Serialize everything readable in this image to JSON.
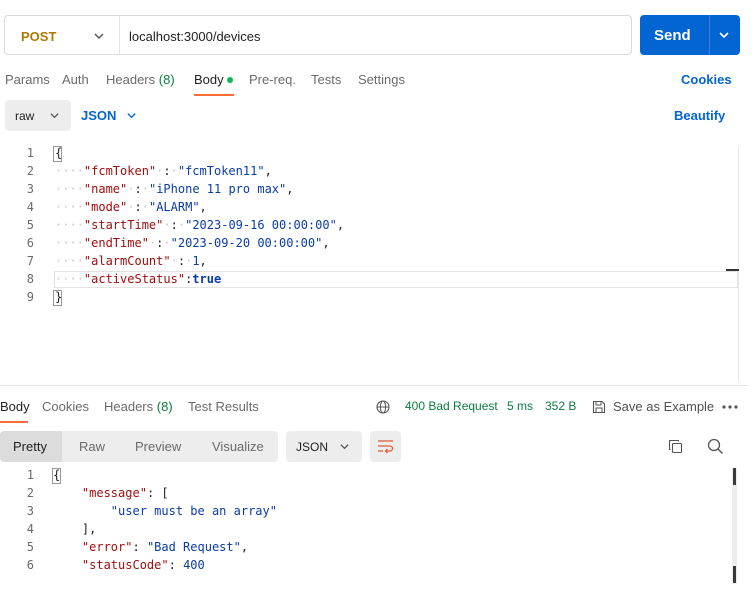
{
  "request": {
    "method": "POST",
    "url": "localhost:3000/devices",
    "send_label": "Send"
  },
  "request_tabs": [
    {
      "label": "Params"
    },
    {
      "label": "Auth"
    },
    {
      "label": "Headers",
      "count": "(8)"
    },
    {
      "label": "Body"
    },
    {
      "label": "Pre-req."
    },
    {
      "label": "Tests"
    },
    {
      "label": "Settings"
    }
  ],
  "cookies_label": "Cookies",
  "body_options": {
    "mode": "raw",
    "format": "JSON",
    "beautify_label": "Beautify"
  },
  "request_body_lines": [
    {
      "num": "1",
      "parts": [
        [
          "p",
          "{"
        ]
      ]
    },
    {
      "num": "2",
      "parts": [
        [
          "dot",
          "····"
        ],
        [
          "k",
          "\"fcmToken\""
        ],
        [
          "dot",
          "·"
        ],
        [
          "p",
          ":"
        ],
        [
          "dot",
          "·"
        ],
        [
          "s",
          "\"fcmToken11\""
        ],
        [
          "p",
          ","
        ]
      ]
    },
    {
      "num": "3",
      "parts": [
        [
          "dot",
          "····"
        ],
        [
          "k",
          "\"name\""
        ],
        [
          "dot",
          "·"
        ],
        [
          "p",
          ":"
        ],
        [
          "dot",
          "·"
        ],
        [
          "s",
          "\"iPhone 11 pro max\""
        ],
        [
          "p",
          ","
        ]
      ]
    },
    {
      "num": "4",
      "parts": [
        [
          "dot",
          "····"
        ],
        [
          "k",
          "\"mode\""
        ],
        [
          "dot",
          "·"
        ],
        [
          "p",
          ":"
        ],
        [
          "dot",
          "·"
        ],
        [
          "s",
          "\"ALARM\""
        ],
        [
          "p",
          ","
        ]
      ]
    },
    {
      "num": "5",
      "parts": [
        [
          "dot",
          "····"
        ],
        [
          "k",
          "\"startTime\""
        ],
        [
          "dot",
          "·"
        ],
        [
          "p",
          ":"
        ],
        [
          "dot",
          "·"
        ],
        [
          "s",
          "\"2023-09-16 00:00:00\""
        ],
        [
          "p",
          ","
        ]
      ]
    },
    {
      "num": "6",
      "parts": [
        [
          "dot",
          "····"
        ],
        [
          "k",
          "\"endTime\""
        ],
        [
          "dot",
          "·"
        ],
        [
          "p",
          ":"
        ],
        [
          "dot",
          "·"
        ],
        [
          "s",
          "\"2023-09-20 00:00:00\""
        ],
        [
          "p",
          ","
        ]
      ]
    },
    {
      "num": "7",
      "parts": [
        [
          "dot",
          "····"
        ],
        [
          "k",
          "\"alarmCount\""
        ],
        [
          "dot",
          "·"
        ],
        [
          "p",
          ":"
        ],
        [
          "dot",
          "·"
        ],
        [
          "n",
          "1"
        ],
        [
          "p",
          ","
        ]
      ]
    },
    {
      "num": "8",
      "parts": [
        [
          "dot",
          "····"
        ],
        [
          "k",
          "\"activeStatus\""
        ],
        [
          "p",
          ":"
        ],
        [
          "b",
          "true"
        ]
      ]
    },
    {
      "num": "9",
      "parts": [
        [
          "p",
          "}"
        ]
      ]
    }
  ],
  "response_tabs": [
    {
      "label": "Body"
    },
    {
      "label": "Cookies"
    },
    {
      "label": "Headers",
      "count": "(8)"
    },
    {
      "label": "Test Results"
    }
  ],
  "response_meta": {
    "status": "400 Bad Request",
    "time": "5 ms",
    "size": "352 B",
    "save_label": "Save as Example"
  },
  "response_views": [
    "Pretty",
    "Raw",
    "Preview",
    "Visualize"
  ],
  "response_format": "JSON",
  "response_body_lines": [
    {
      "num": "1",
      "parts": [
        [
          "p",
          "{"
        ]
      ]
    },
    {
      "num": "2",
      "parts": [
        [
          "p",
          "    "
        ],
        [
          "k",
          "\"message\""
        ],
        [
          "p",
          ": ["
        ]
      ]
    },
    {
      "num": "3",
      "parts": [
        [
          "p",
          "        "
        ],
        [
          "s",
          "\"user must be an array\""
        ]
      ]
    },
    {
      "num": "4",
      "parts": [
        [
          "p",
          "    ],"
        ]
      ]
    },
    {
      "num": "5",
      "parts": [
        [
          "p",
          "    "
        ],
        [
          "k",
          "\"error\""
        ],
        [
          "p",
          ": "
        ],
        [
          "s",
          "\"Bad Request\""
        ],
        [
          "p",
          ","
        ]
      ]
    },
    {
      "num": "6",
      "parts": [
        [
          "p",
          "    "
        ],
        [
          "k",
          "\"statusCode\""
        ],
        [
          "p",
          ": "
        ],
        [
          "n",
          "400"
        ]
      ]
    },
    {
      "num": "7",
      "parts": [
        [
          "p",
          "}"
        ]
      ]
    }
  ],
  "colors": {
    "accent": "#0265d2",
    "method": "#ad7a03",
    "tab_underline": "#ff6c37",
    "success": "#0a7d3f"
  },
  "icons": [
    "chevron-down-icon",
    "globe-icon",
    "save-icon",
    "more-icon",
    "copy-icon",
    "search-icon",
    "wrap-lines-icon"
  ]
}
